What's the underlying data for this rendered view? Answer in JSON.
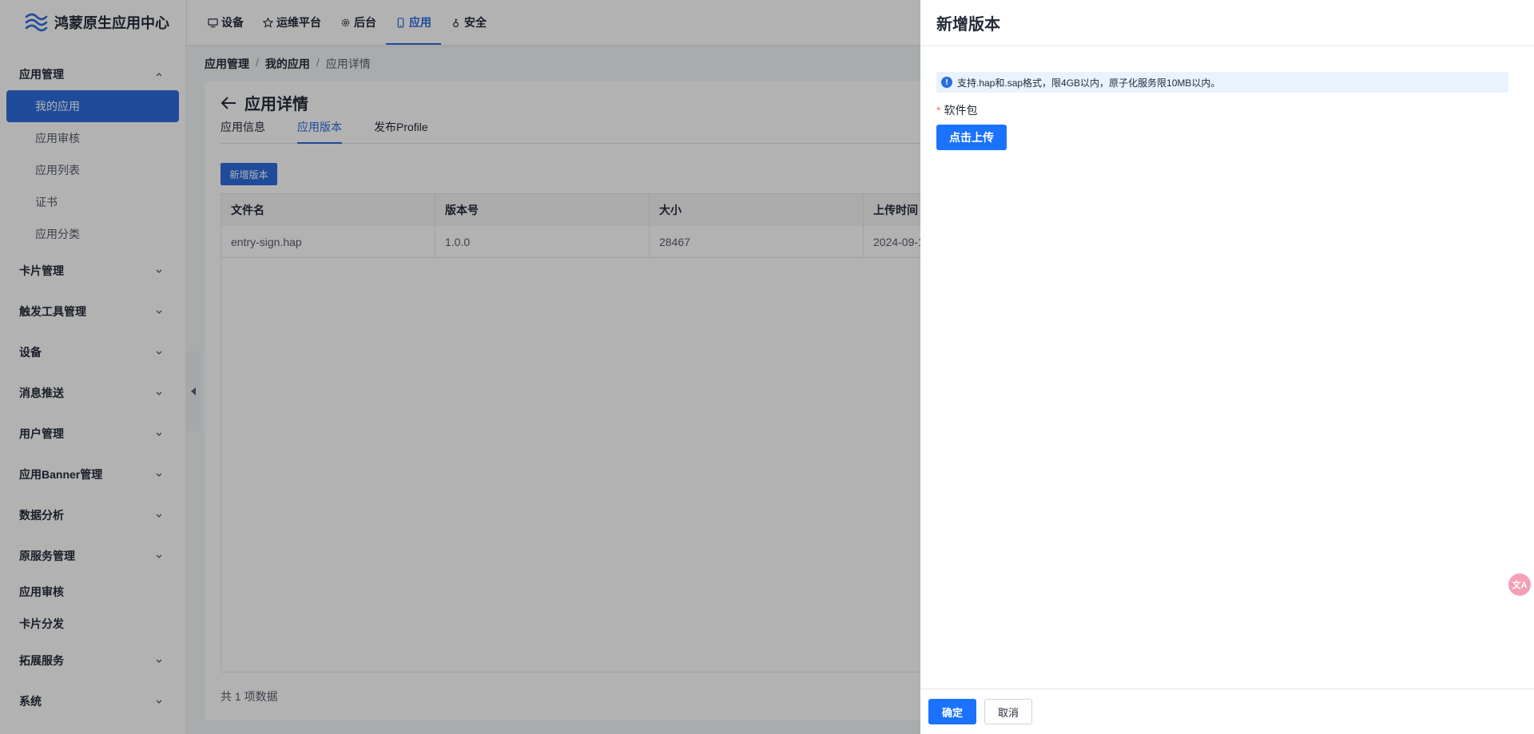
{
  "app": {
    "title": "鸿蒙原生应用中心"
  },
  "topnav": [
    {
      "label": "设备",
      "icon": "monitor-icon"
    },
    {
      "label": "运维平台",
      "icon": "star-icon"
    },
    {
      "label": "后台",
      "icon": "gear-icon"
    },
    {
      "label": "应用",
      "icon": "phone-icon",
      "active": true
    },
    {
      "label": "安全",
      "icon": "key-icon"
    }
  ],
  "sidebar": {
    "group_app": "应用管理",
    "sub_items": [
      "我的应用",
      "应用审核",
      "应用列表",
      "证书",
      "应用分类"
    ],
    "groups": [
      "卡片管理",
      "触发工具管理",
      "设备",
      "消息推送",
      "用户管理",
      "应用Banner管理",
      "数据分析",
      "原服务管理"
    ],
    "plain": [
      "应用审核",
      "卡片分发"
    ],
    "groups2": [
      "拓展服务",
      "系统"
    ]
  },
  "breadcrumb": {
    "level1": "应用管理",
    "level2": "我的应用",
    "level3": "应用详情",
    "sep": "/"
  },
  "page": {
    "title": "应用详情",
    "tabs": [
      "应用信息",
      "应用版本",
      "发布Profile"
    ],
    "add_button": "新增版本",
    "table": {
      "columns": [
        "文件名",
        "版本号",
        "大小",
        "上传时间"
      ],
      "rows": [
        [
          "entry-sign.hap",
          "1.0.0",
          "28467",
          "2024-09-1"
        ]
      ]
    },
    "total": "共 1 项数据"
  },
  "drawer": {
    "title": "新增版本",
    "info": "支持.hap和.sap格式，限4GB以内，原子化服务限10MB以内。",
    "field_required": "*",
    "field_label": "软件包",
    "upload_button": "点击上传",
    "ok_button": "确定",
    "cancel_button": "取消"
  }
}
